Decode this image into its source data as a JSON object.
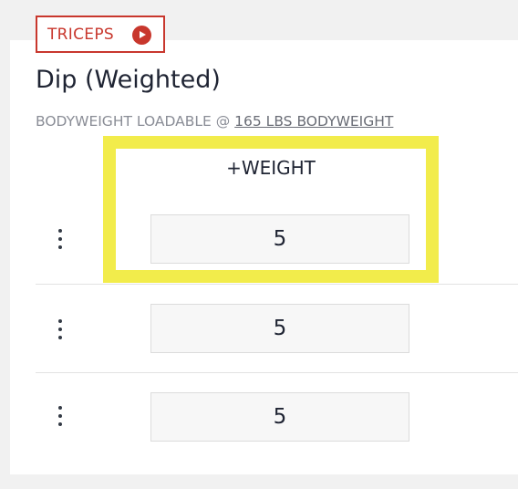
{
  "exercise": {
    "muscle_tag": "TRICEPS",
    "title": "Dip (Weighted)",
    "subtitle_prefix": "BODYWEIGHT LOADABLE @ ",
    "bodyweight_link": "165 LBS BODYWEIGHT"
  },
  "table": {
    "column_header": "+WEIGHT",
    "sets": [
      {
        "weight": "5"
      },
      {
        "weight": "5"
      },
      {
        "weight": "5"
      }
    ]
  },
  "colors": {
    "accent": "#c8372d",
    "highlight": "#f2ec4b"
  },
  "icons": {
    "muscle_tag": "play-circle-icon",
    "row_menu": "kebab-menu-icon"
  }
}
